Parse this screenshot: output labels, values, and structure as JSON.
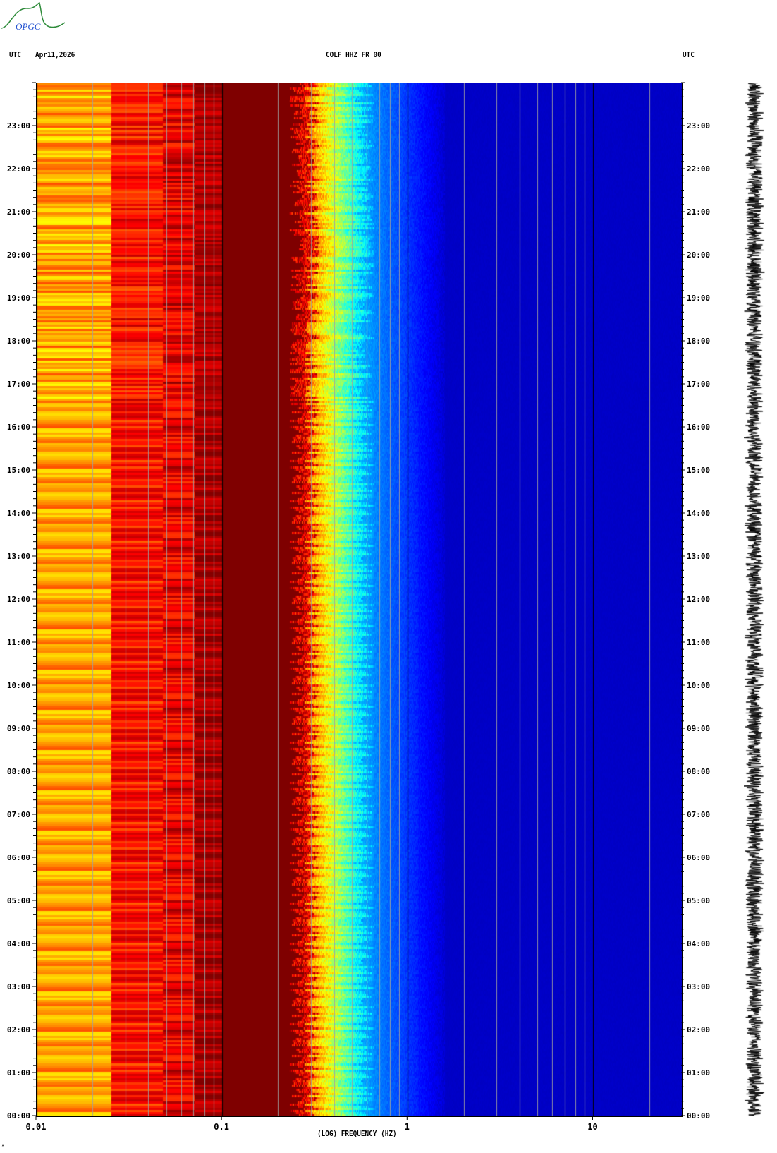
{
  "header": {
    "left_tz": "UTC",
    "date": "Apr11,2026",
    "station": "COLF HHZ FR 00",
    "right_tz": "UTC"
  },
  "logo_text": "OPGC",
  "footer_mark": "ᴬ",
  "chart_data": {
    "type": "heatmap",
    "title": "COLF HHZ FR 00",
    "xlabel": "(LOG) FREQUENCY (HZ)",
    "ylabel": "UTC",
    "xscale": "log",
    "xlim": [
      0.01,
      30
    ],
    "ylim_hours": [
      0,
      24
    ],
    "x_ticks": [
      "0.01",
      "0.1",
      "1",
      "10"
    ],
    "y_ticks": [
      "00:00",
      "01:00",
      "02:00",
      "03:00",
      "04:00",
      "05:00",
      "06:00",
      "07:00",
      "08:00",
      "09:00",
      "10:00",
      "11:00",
      "12:00",
      "13:00",
      "14:00",
      "15:00",
      "16:00",
      "17:00",
      "18:00",
      "19:00",
      "20:00",
      "21:00",
      "22:00",
      "23:00"
    ],
    "colormap": "jet",
    "bands": [
      {
        "f_range": [
          0.01,
          0.025
        ],
        "level": "high (yellow/green)"
      },
      {
        "f_range": [
          0.025,
          0.07
        ],
        "level": "very high (orange/red)"
      },
      {
        "f_range": [
          0.07,
          0.27
        ],
        "level": "saturated (dark red)"
      },
      {
        "f_range": [
          0.3,
          0.6
        ],
        "level": "decreasing (yellow to cyan)"
      },
      {
        "f_range": [
          0.6,
          30
        ],
        "level": "low (blue)"
      }
    ],
    "grid": true
  }
}
